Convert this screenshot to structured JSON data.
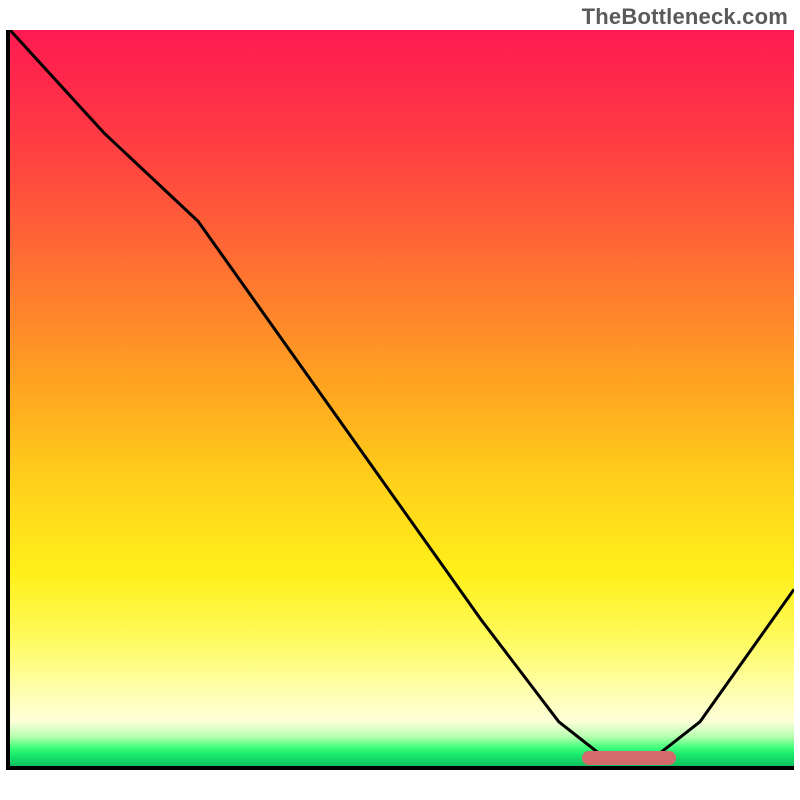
{
  "watermark": "TheBottleneck.com",
  "colors": {
    "curve": "#000000",
    "axis": "#000000",
    "marker": "#d46a6e"
  },
  "chart_data": {
    "type": "line",
    "title": "",
    "xlabel": "",
    "ylabel": "",
    "xlim": [
      0,
      100
    ],
    "ylim": [
      0,
      100
    ],
    "series": [
      {
        "name": "curve",
        "x": [
          0,
          12,
          24,
          36,
          48,
          60,
          70,
          76,
          82,
          88,
          100
        ],
        "y": [
          100,
          86,
          74,
          56,
          38,
          20,
          6,
          1,
          1,
          6,
          24
        ]
      }
    ],
    "marker": {
      "x_start": 73,
      "x_end": 85,
      "y": 0.8
    },
    "gradient_note": "background encodes score: red (high mismatch) at top through yellow to green (good) at bottom"
  }
}
